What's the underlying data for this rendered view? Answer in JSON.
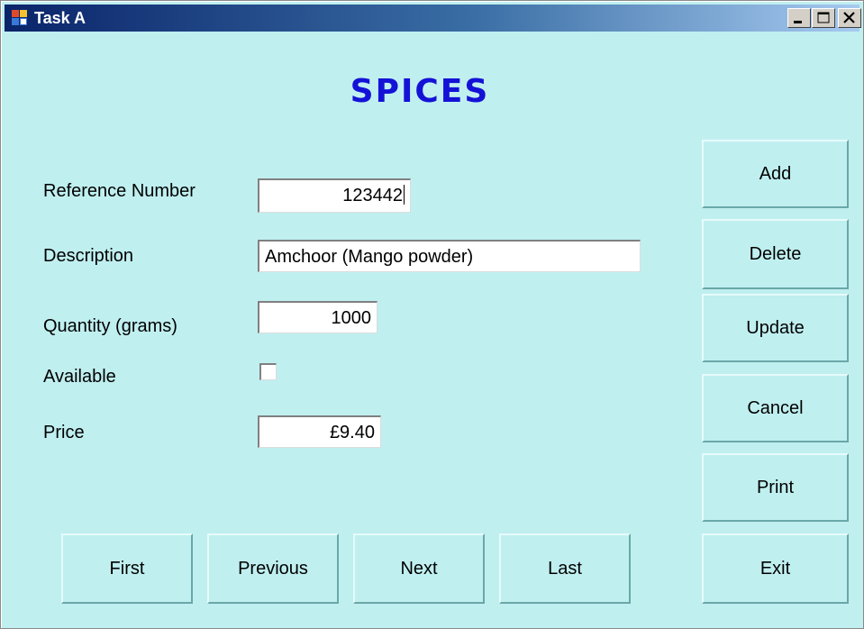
{
  "window": {
    "title": "Task A",
    "icon": "app-form-icon",
    "controls": {
      "minimize_icon": "minimize-icon",
      "maximize_icon": "maximize-icon",
      "close_icon": "close-icon"
    }
  },
  "form": {
    "heading": "SPICES",
    "fields": {
      "reference_number": {
        "label": "Reference Number",
        "value": "123442"
      },
      "description": {
        "label": "Description",
        "value": "Amchoor (Mango powder)"
      },
      "quantity": {
        "label": "Quantity (grams)",
        "value": "1000"
      },
      "available": {
        "label": "Available",
        "checked": false
      },
      "price": {
        "label": "Price",
        "value": "£9.40"
      }
    }
  },
  "side_buttons": {
    "add": "Add",
    "delete": "Delete",
    "update": "Update",
    "cancel": "Cancel",
    "print": "Print",
    "exit": "Exit"
  },
  "nav_buttons": {
    "first": "First",
    "previous": "Previous",
    "next": "Next",
    "last": "Last"
  },
  "colors": {
    "form_background": "#c0eff0",
    "heading": "#1412d6",
    "title_bar_start": "#0a246a",
    "title_bar_end": "#a6caf0"
  }
}
